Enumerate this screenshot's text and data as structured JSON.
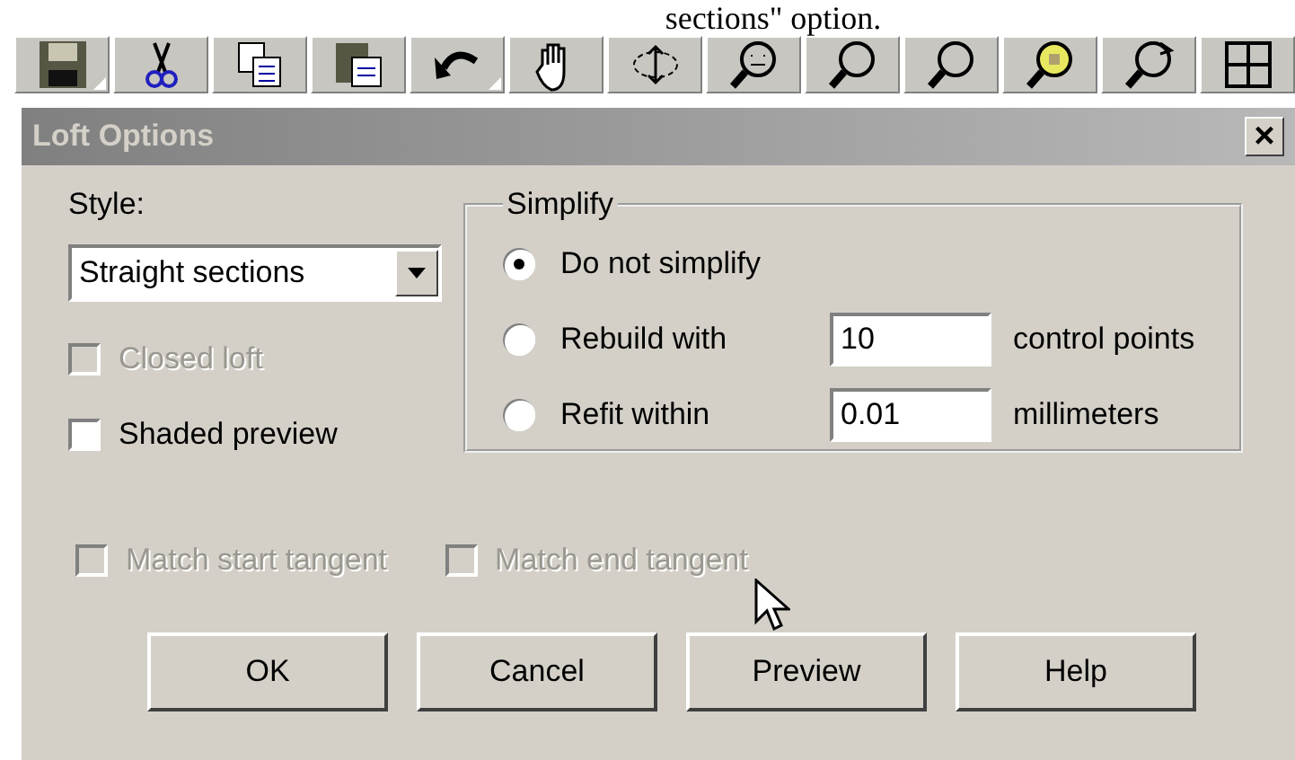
{
  "caption": "sections\" option.",
  "toolbar": {
    "buttons": [
      {
        "kind": "save",
        "has_menu": true
      },
      {
        "kind": "cut",
        "has_menu": false
      },
      {
        "kind": "copy",
        "has_menu": false
      },
      {
        "kind": "paste",
        "has_menu": false
      },
      {
        "kind": "undo",
        "has_menu": true
      },
      {
        "kind": "hand",
        "has_menu": false
      },
      {
        "kind": "rotate",
        "has_menu": false
      },
      {
        "kind": "zoom-face",
        "has_menu": false
      },
      {
        "kind": "zoom-select",
        "has_menu": false
      },
      {
        "kind": "zoom-fit",
        "has_menu": false
      },
      {
        "kind": "zoom-yellow",
        "has_menu": false
      },
      {
        "kind": "zoom-back",
        "has_menu": false
      },
      {
        "kind": "grid",
        "has_menu": false
      }
    ]
  },
  "dialog": {
    "title": "Loft Options",
    "close": "×",
    "style": {
      "label": "Style:",
      "value": "Straight sections"
    },
    "options": [
      {
        "label": "Closed loft",
        "checked": false,
        "disabled": true
      },
      {
        "label": "Shaded preview",
        "checked": false,
        "disabled": false
      }
    ],
    "simplify": {
      "title": "Simplify",
      "choices": [
        {
          "label": "Do not simplify",
          "selected": true
        },
        {
          "label": "Rebuild with",
          "selected": false,
          "value": "10",
          "unit": "control points"
        },
        {
          "label": "Refit within",
          "selected": false,
          "value": "0.01",
          "unit": "millimeters"
        }
      ]
    },
    "tangents": [
      {
        "label": "Match start tangent",
        "checked": false,
        "disabled": true
      },
      {
        "label": "Match end tangent",
        "checked": false,
        "disabled": true
      }
    ],
    "buttons": [
      "OK",
      "Cancel",
      "Preview",
      "Help"
    ]
  }
}
